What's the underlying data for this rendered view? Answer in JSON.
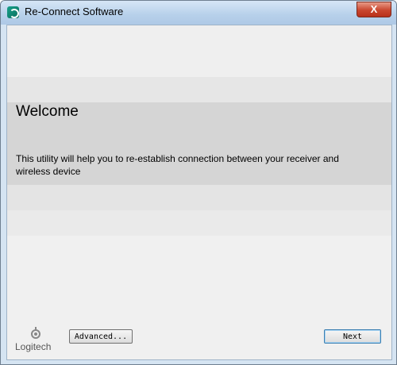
{
  "window": {
    "title": "Re-Connect Software",
    "close_glyph": "X"
  },
  "content": {
    "heading": "Welcome",
    "description": "This utility will help you to re-establish connection between your receiver and wireless device"
  },
  "footer": {
    "logo_text": "Logitech",
    "advanced_label": "Advanced...",
    "next_label": "Next"
  },
  "icons": {
    "app": "reconnect-app-icon",
    "logo": "logitech-logo-icon"
  },
  "colors": {
    "brand_teal": "#17a08a",
    "close_red": "#c9462e"
  }
}
